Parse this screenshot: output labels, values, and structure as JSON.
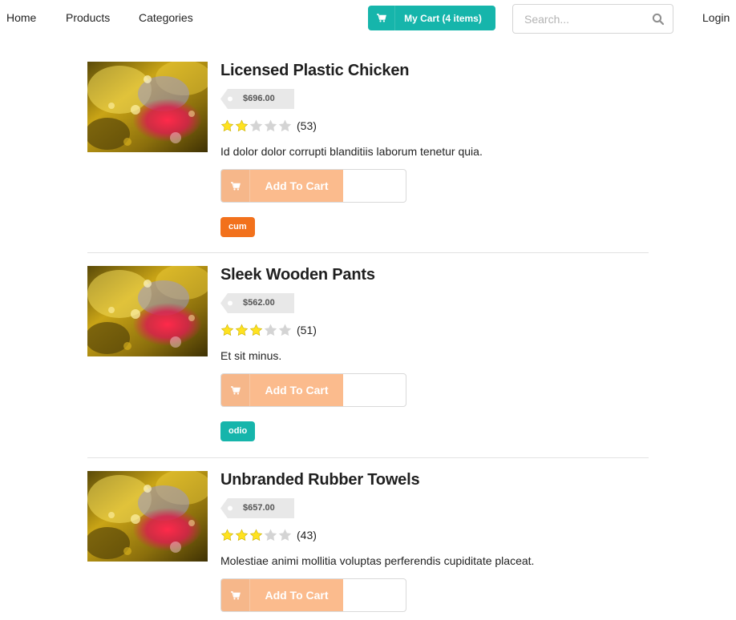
{
  "nav": {
    "home": "Home",
    "products": "Products",
    "categories": "Categories",
    "cart_label": "My Cart (4 items)",
    "cart_icon": "shopping-cart-icon",
    "search_placeholder": "Search...",
    "search_value": "",
    "search_icon": "search-icon",
    "login": "Login"
  },
  "colors": {
    "accent_teal": "#16b5ab",
    "add_to_cart": "#fbbb8d",
    "star_filled": "#ffe21f",
    "star_empty": "#d4d4d4",
    "tag_orange": "#f2711c",
    "tag_teal": "#16b5ab"
  },
  "products": [
    {
      "title": "Licensed Plastic Chicken",
      "price": "$696.00",
      "rating": 2,
      "rating_max": 5,
      "reviews": "(53)",
      "description": "Id dolor dolor corrupti blanditiis laborum tenetur quia.",
      "add_label": "Add To Cart",
      "tag": "cum",
      "tag_color": "#f2711c"
    },
    {
      "title": "Sleek Wooden Pants",
      "price": "$562.00",
      "rating": 3,
      "rating_max": 5,
      "reviews": "(51)",
      "description": "Et sit minus.",
      "add_label": "Add To Cart",
      "tag": "odio",
      "tag_color": "#16b5ab"
    },
    {
      "title": "Unbranded Rubber Towels",
      "price": "$657.00",
      "rating": 3,
      "rating_max": 5,
      "reviews": "(43)",
      "description": "Molestiae animi mollitia voluptas perferendis cupiditate placeat.",
      "add_label": "Add To Cart",
      "tag": "",
      "tag_color": ""
    }
  ]
}
